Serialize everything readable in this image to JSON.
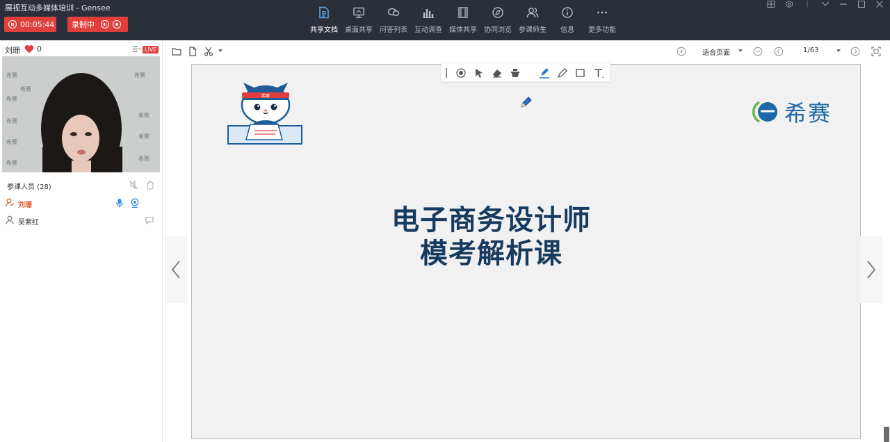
{
  "app": {
    "title": "展视互动多媒体培训  - Gensee",
    "timer": "00:05:44",
    "recording_label": "录制中"
  },
  "nav": {
    "items": [
      {
        "label": "共享文档",
        "icon": "document-icon",
        "active": true
      },
      {
        "label": "桌面共享",
        "icon": "desktop-share-icon",
        "active": false
      },
      {
        "label": "问答列表",
        "icon": "qa-list-icon",
        "active": false
      },
      {
        "label": "互动调查",
        "icon": "survey-icon",
        "active": false
      },
      {
        "label": "媒体共享",
        "icon": "media-share-icon",
        "active": false
      },
      {
        "label": "协同浏览",
        "icon": "co-browse-icon",
        "active": false
      },
      {
        "label": "参课师生",
        "icon": "participants-icon",
        "active": false
      },
      {
        "label": "信息",
        "icon": "info-icon",
        "active": false
      },
      {
        "label": "更多功能",
        "icon": "more-icon",
        "active": false
      }
    ]
  },
  "host_panel": {
    "name": "刘珊",
    "likes": "0",
    "live_badge": "LIVE"
  },
  "video": {
    "watermark": "希赛"
  },
  "attendees": {
    "title": "参课人员 (28)",
    "list": [
      {
        "name": "刘珊",
        "role": "host"
      },
      {
        "name": "吴紫红",
        "role": "student"
      }
    ]
  },
  "doc_toolbar": {
    "fit_mode": "适合页面",
    "page_indicator": "1/63"
  },
  "slide": {
    "title_line1": "电子商务设计师",
    "title_line2": "模考解析课",
    "brand_name": "希赛",
    "mascot_text": "希赛"
  },
  "colors": {
    "topbar": "#2b2f3a",
    "record_red": "#e0403c",
    "slide_title": "#173b5e",
    "brand_blue": "#1f67a6",
    "brand_green": "#5bb94a",
    "host_orange": "#e05a2c"
  }
}
